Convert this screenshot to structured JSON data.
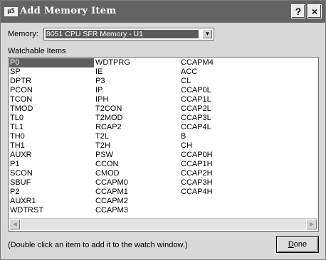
{
  "window": {
    "title": "Add Memory Item",
    "app_icon": "μVision logo"
  },
  "title_buttons": {
    "help": "?",
    "close": "×"
  },
  "memory": {
    "label": "Memory:",
    "value": "8051 CPU SFR Memory - U1"
  },
  "list": {
    "label": "Watchable Items",
    "selected": "P0",
    "columns": [
      [
        "P0",
        "SP",
        "DPTR",
        "PCON",
        "TCON",
        "TMOD",
        "TL0",
        "TL1",
        "TH0",
        "TH1",
        "AUXR",
        "P1",
        "SCON",
        "SBUF",
        "P2",
        "AUXR1",
        "WDTRST"
      ],
      [
        "WDTPRG",
        "IE",
        "P3",
        "IP",
        "IPH",
        "T2CON",
        "T2MOD",
        "RCAP2",
        "T2L",
        "T2H",
        "PSW",
        "CCON",
        "CMOD",
        "CCAPM0",
        "CCAPM1",
        "CCAPM2",
        "CCAPM3"
      ],
      [
        "CCAPM4",
        "ACC",
        "CL",
        "CCAP0L",
        "CCAP1L",
        "CCAP2L",
        "CCAP3L",
        "CCAP4L",
        "B",
        "CH",
        "CCAP0H",
        "CCAP1H",
        "CCAP2H",
        "CCAP3H",
        "CCAP4H"
      ]
    ]
  },
  "hint": "(Double click an item to add it to the watch window.)",
  "done_button": "Done"
}
